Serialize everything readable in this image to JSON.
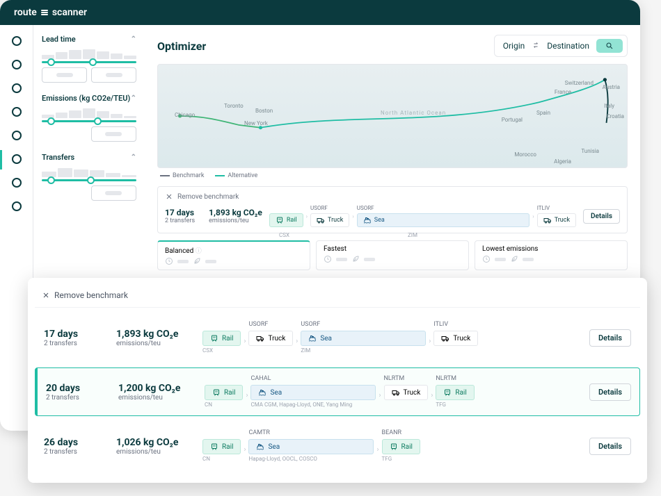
{
  "brand": {
    "prefix": "route",
    "suffix": "scanner"
  },
  "filters": {
    "lead_time": {
      "label": "Lead time"
    },
    "emissions": {
      "label": "Emissions (kg CO2e/TEU)"
    },
    "transfers": {
      "label": "Transfers"
    }
  },
  "page": {
    "title": "Optimizer",
    "origin_label": "Origin",
    "destination_label": "Destination"
  },
  "map": {
    "legend": {
      "benchmark": "Benchmark",
      "alternative": "Alternative"
    },
    "places": {
      "chicago": "Chicago",
      "toronto": "Toronto",
      "boston": "Boston",
      "newyork": "New York",
      "natlantic": "North Atlantic Ocean",
      "portugal": "Portugal",
      "spain": "Spain",
      "france": "France",
      "switzerland": "Switzerland",
      "austria": "Austria",
      "italy": "Italy",
      "croatia": "Croatia",
      "morocco": "Morocco",
      "algeria": "Algeria",
      "tunisia": "Tunisia"
    }
  },
  "colors": {
    "primary": "#1fbda4",
    "dark": "#0b3a3e"
  },
  "metric_tabs": {
    "balanced": "Balanced",
    "fastest": "Fastest",
    "lowest": "Lowest emissions",
    "carrier_top": "CSX",
    "carrier_sea": "ZIM"
  },
  "modalities": {
    "rail": "Rail",
    "truck": "Truck",
    "sea": "Sea"
  },
  "bench_mini": {
    "remove": "Remove benchmark",
    "days": "17 days",
    "transfers": "2 transfers",
    "emissions_v": "1,893 kg CO₂e",
    "emissions_l": "emissions/teu",
    "codes": {
      "usorf1": "USORF",
      "usorf2": "USORF",
      "itliv": "ITLIV"
    },
    "details": "Details"
  },
  "overlay": {
    "remove": "Remove benchmark",
    "details": "Details",
    "rows": [
      {
        "days": "17 days",
        "transfers": "2 transfers",
        "em_v": "1,893 kg CO₂e",
        "em_l": "emissions/teu",
        "segs": [
          {
            "code": "",
            "mode": "rail",
            "label": "Rail",
            "carrier": "CSX"
          },
          {
            "code": "USORF",
            "mode": "truck",
            "label": "Truck",
            "carrier": ""
          },
          {
            "code": "USORF",
            "mode": "sea",
            "label": "Sea",
            "carrier": "ZIM",
            "wide": true
          },
          {
            "code": "ITLIV",
            "mode": "truck",
            "label": "Truck",
            "carrier": ""
          }
        ]
      },
      {
        "days": "20 days",
        "transfers": "2 transfers",
        "em_v": "1,200 kg CO₂e",
        "em_l": "emissions/teu",
        "selected": true,
        "segs": [
          {
            "code": "",
            "mode": "rail",
            "label": "Rail",
            "carrier": "CN"
          },
          {
            "code": "CAHAL",
            "mode": "sea",
            "label": "Sea",
            "carrier": "CMA CGM, Hapag-Lloyd, ONE, Yang Ming",
            "wide": true
          },
          {
            "code": "NLRTM",
            "mode": "truck",
            "label": "Truck",
            "carrier": ""
          },
          {
            "code": "NLRTM",
            "mode": "rail",
            "label": "Rail",
            "carrier": "TFG"
          }
        ]
      },
      {
        "days": "26 days",
        "transfers": "2 transfers",
        "em_v": "1,026 kg CO₂e",
        "em_l": "emissions/teu",
        "segs": [
          {
            "code": "",
            "mode": "rail",
            "label": "Rail",
            "carrier": "CN"
          },
          {
            "code": "CAMTR",
            "mode": "sea",
            "label": "Sea",
            "carrier": "Hapag-Lloyd, OOCL, COSCO",
            "wide": true
          },
          {
            "code": "BEANR",
            "mode": "rail",
            "label": "Rail",
            "carrier": "TFG"
          }
        ]
      }
    ]
  }
}
